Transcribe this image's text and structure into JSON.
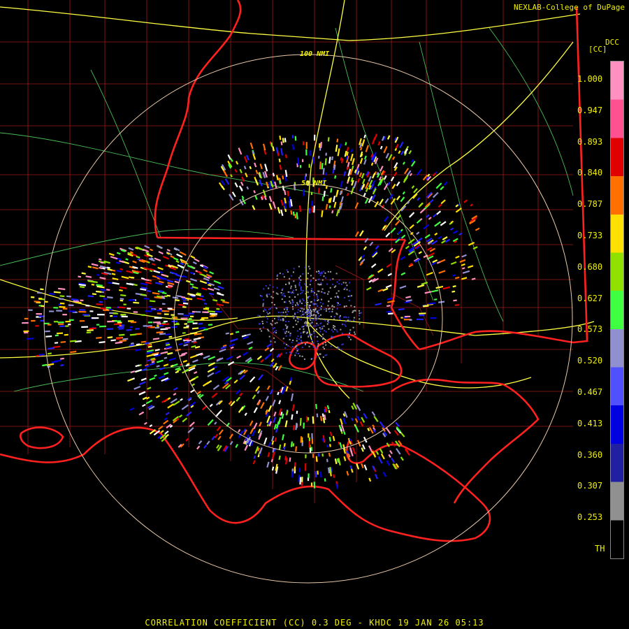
{
  "credit": "NEXLAB-College of DuPage",
  "product_code": "DCC",
  "unit_label": "[CC]",
  "caption": "CORRELATION COEFFICIENT (CC) 0.3 DEG - KHDC 19 JAN 26 05:13",
  "range_rings": {
    "outer": "100 NMI",
    "inner": "50 NMI"
  },
  "colorbar": {
    "ticks": [
      "1.000",
      "0.947",
      "0.893",
      "0.840",
      "0.787",
      "0.733",
      "0.680",
      "0.627",
      "0.573",
      "0.520",
      "0.467",
      "0.413",
      "0.360",
      "0.307",
      "0.253",
      "TH"
    ],
    "colors": [
      "#ff90c0",
      "#ff5090",
      "#e00000",
      "#ff7000",
      "#ffe000",
      "#90e000",
      "#40ff40",
      "#9090d0",
      "#5050ff",
      "#0000e0",
      "#2020a0",
      "#909090",
      "#000000"
    ]
  },
  "colors": {
    "state_border": "#ff2020",
    "county_border": "#b01818",
    "highway": "#ffff40",
    "road": "#50d060",
    "range_ring": "#e8c8a8",
    "text": "#f0f000"
  }
}
